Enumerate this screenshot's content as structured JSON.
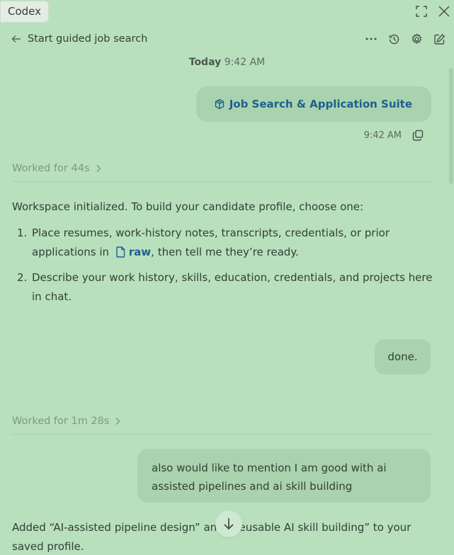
{
  "app": {
    "name": "Codex"
  },
  "header": {
    "title": "Start guided job search"
  },
  "chat": {
    "date_label": "Today",
    "date_time": "9:42 AM",
    "attachment_chip": "Job Search & Application Suite",
    "attachment_time": "9:42 AM",
    "worked_1": "Worked for 44s",
    "assistant_1_intro": "Workspace initialized. To build your candidate profile, choose one:",
    "option_1_num": "1.",
    "option_1_part1": "Place resumes, work-history notes, transcripts, credentials, or prior applications in",
    "option_1_link": "raw",
    "option_1_part2": ", then tell me they’re ready.",
    "option_2_num": "2.",
    "option_2_text": "Describe your work history, skills, education, credentials, and projects here in chat.",
    "user_1": "done.",
    "worked_2": "Worked for 1m 28s",
    "user_2": "also would like to mention I am good with ai assisted pipelines and ai skill building",
    "assistant_2": "Added “AI-assisted pipeline design” and “Reusable AI skill building” to your saved profile."
  },
  "colors": {
    "background": "#b8e0bd",
    "bubble": "#a9d3ae",
    "link": "#1f5f8f"
  },
  "icons": [
    "expand-icon",
    "close-icon",
    "back-arrow-icon",
    "more-icon",
    "history-icon",
    "settings-icon",
    "compose-icon",
    "cube-icon",
    "copy-icon",
    "chevron-right-icon",
    "file-icon",
    "arrow-down-icon"
  ]
}
